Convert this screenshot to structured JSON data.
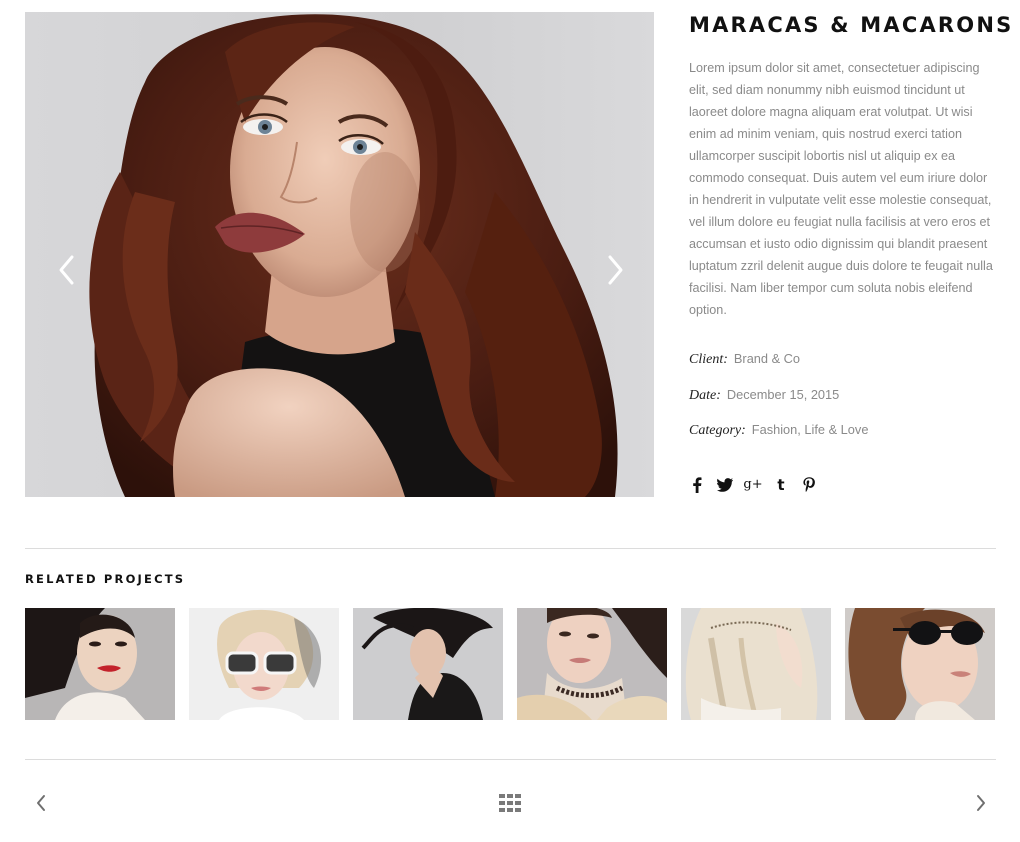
{
  "project": {
    "title": "MARACAS & MACARONS",
    "description": "Lorem ipsum dolor sit amet, consectetuer adipiscing elit, sed diam nonummy nibh euismod tincidunt ut laoreet dolore magna aliquam erat volutpat. Ut wisi enim ad minim veniam, quis nostrud exerci tation ullamcorper suscipit lobortis nisl ut aliquip ex ea commodo consequat. Duis autem vel eum iriure dolor in hendrerit in vulputate velit esse molestie consequat, vel illum dolore eu feugiat nulla facilisis at vero eros et accumsan et iusto odio dignissim qui blandit praesent luptatum zzril delenit augue duis dolore te feugait nulla facilisi. Nam liber tempor cum soluta nobis eleifend option.",
    "meta": {
      "client_label": "Client:",
      "client_value": "Brand & Co",
      "date_label": "Date:",
      "date_value": "December 15, 2015",
      "category_label": "Category:",
      "category_value": "Fashion, Life & Love"
    }
  },
  "slider": {
    "prev_icon": "chevron-left-icon",
    "next_icon": "chevron-right-icon"
  },
  "social_icons": [
    "facebook-icon",
    "twitter-icon",
    "google-plus-icon",
    "tumblr-icon",
    "pinterest-icon"
  ],
  "social_glyphs": {
    "google_plus": "g+",
    "tumblr": "t"
  },
  "related": {
    "heading": "RELATED PROJECTS",
    "count": 6
  },
  "bottom_nav": {
    "prev_icon": "chevron-left-icon",
    "grid_icon": "grid-icon",
    "next_icon": "chevron-right-icon"
  },
  "colors": {
    "title": "#111111",
    "body_text": "#8a8a8a",
    "divider": "#dcdcdc",
    "icon": "#7a7a7a"
  }
}
